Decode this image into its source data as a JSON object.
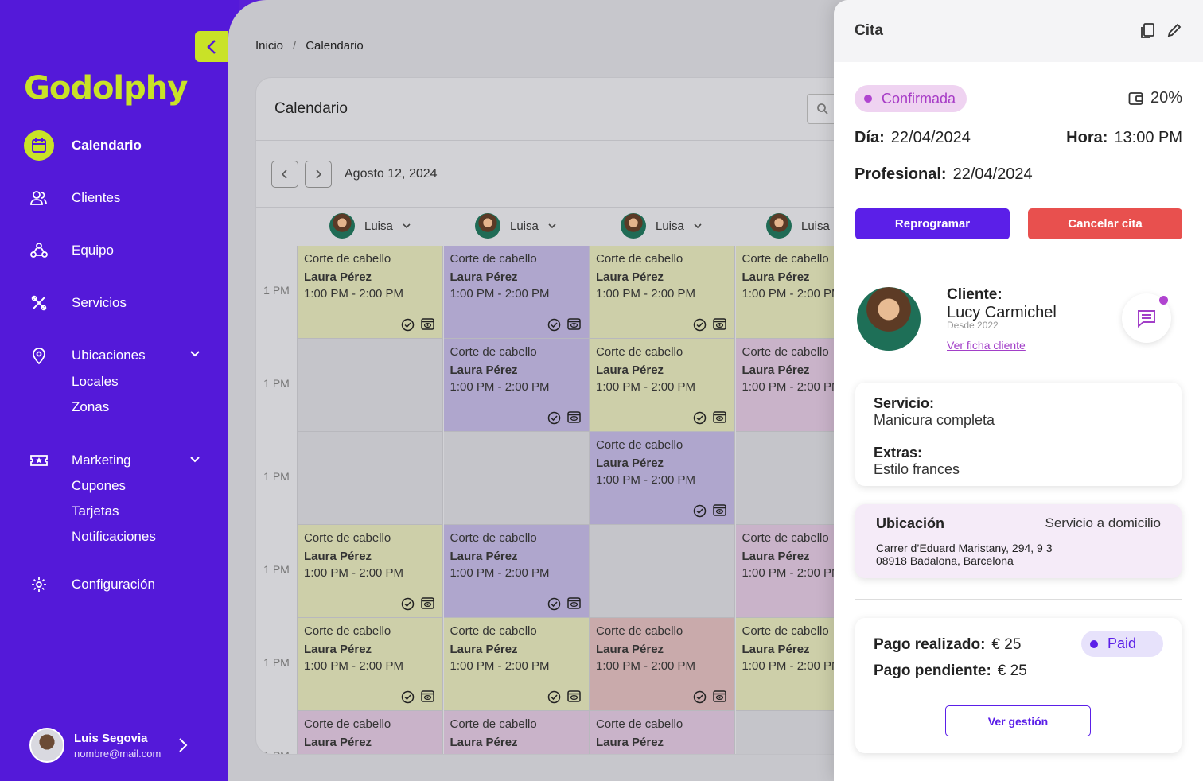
{
  "sidebar": {
    "brand": "Godolphy",
    "items": [
      {
        "label": "Calendario"
      },
      {
        "label": "Clientes"
      },
      {
        "label": "Equipo"
      },
      {
        "label": "Servicios"
      },
      {
        "label": "Ubicaciones",
        "children": [
          "Locales",
          "Zonas"
        ]
      },
      {
        "label": "Marketing",
        "children": [
          "Cupones",
          "Tarjetas",
          "Notificaciones"
        ]
      },
      {
        "label": "Configuración"
      }
    ],
    "user": {
      "name": "Luis Segovia",
      "email": "nombre@mail.com"
    }
  },
  "breadcrumb": {
    "home": "Inicio",
    "sep": "/",
    "current": "Calendario"
  },
  "calendar": {
    "title": "Calendario",
    "date": "Agosto 12,  2024",
    "professionals": [
      "Luisa",
      "Luisa",
      "Luisa",
      "Luisa"
    ],
    "hour_label": "1 PM",
    "appt": {
      "service": "Corte de cabello",
      "client": "Laura Pérez",
      "time": "1:00 PM - 2:00 PM"
    }
  },
  "panel": {
    "title": "Cita",
    "status": "Confirmada",
    "discount": "20%",
    "day_label": "Día:",
    "day": "22/04/2024",
    "hour_label": "Hora:",
    "hour": "13:00 PM",
    "pro_label": "Profesional:",
    "pro": "22/04/2024",
    "reschedule": "Reprogramar",
    "cancel": "Cancelar cita",
    "client_label": "Cliente:",
    "client_name": "Lucy Carmichel",
    "client_since": "Desde 2022",
    "client_link": "Ver ficha cliente",
    "service_label": "Servicio:",
    "service": "Manicura completa",
    "extras_label": "Extras:",
    "extras": "Estilo frances",
    "location_label": "Ubicación",
    "location_type": "Servicio a domicilio",
    "address1": "Carrer d’Eduard Maristany, 294, 9 3",
    "address2": "08918 Badalona, Barcelona",
    "paid_label": "Pago realizado:",
    "paid": "€ 25",
    "pending_label": "Pago pendiente:",
    "pending": "€ 25",
    "pay_status": "Paid",
    "manage": "Ver gestión"
  },
  "colors": {
    "primary": "#5419d9",
    "accent": "#c9e227",
    "danger": "#e8504e",
    "status_bg": "#efd3f1"
  }
}
